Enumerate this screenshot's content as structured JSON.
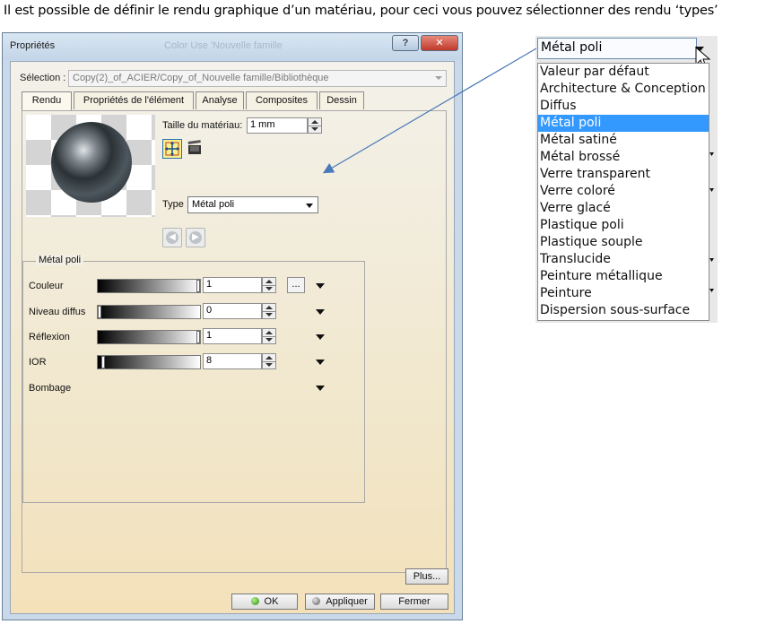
{
  "caption": "Il est possible de définir le rendu graphique d’un matériau, pour ceci vous pouvez sélectionner des rendu ‘types’",
  "window": {
    "title": "Propriétés",
    "ghost_title": "Color Use 'Nouvelle famille",
    "help_label": "?",
    "close_label": "✕"
  },
  "selection": {
    "label": "Sélection :",
    "value": "Copy(2)_of_ACIER/Copy_of_Nouvelle famille/Bibliothèque"
  },
  "tabs": [
    {
      "label": "Rendu",
      "active": true
    },
    {
      "label": "Propriétés de l'élément"
    },
    {
      "label": "Analyse"
    },
    {
      "label": "Composites"
    },
    {
      "label": "Dessin"
    }
  ],
  "rendu": {
    "size_label": "Taille du matériau:",
    "size_value": "1 mm",
    "type_label": "Type :",
    "type_value": "Métal poli",
    "group_title": "Métal poli",
    "rows": [
      {
        "label": "Couleur",
        "value": "1"
      },
      {
        "label": "Niveau diffus",
        "value": "0"
      },
      {
        "label": "Réflexion",
        "value": "1"
      },
      {
        "label": "IOR",
        "value": "8"
      },
      {
        "label": "Bombage",
        "value": ""
      }
    ],
    "dots_label": "..."
  },
  "buttons": {
    "plus": "Plus...",
    "ok": "OK",
    "apply": "Appliquer",
    "close": "Fermer"
  },
  "dropdown": {
    "selected": "Métal poli",
    "options": [
      "Valeur par défaut",
      "Architecture & Conception",
      "Diffus",
      "Métal poli",
      "Métal satiné",
      "Métal brossé",
      "Verre transparent",
      "Verre coloré",
      "Verre glacé",
      "Plastique poli",
      "Plastique souple",
      "Translucide",
      "Peinture métallique",
      "Peinture",
      "Dispersion sous-surface"
    ],
    "highlight_color": "#3399ff"
  }
}
